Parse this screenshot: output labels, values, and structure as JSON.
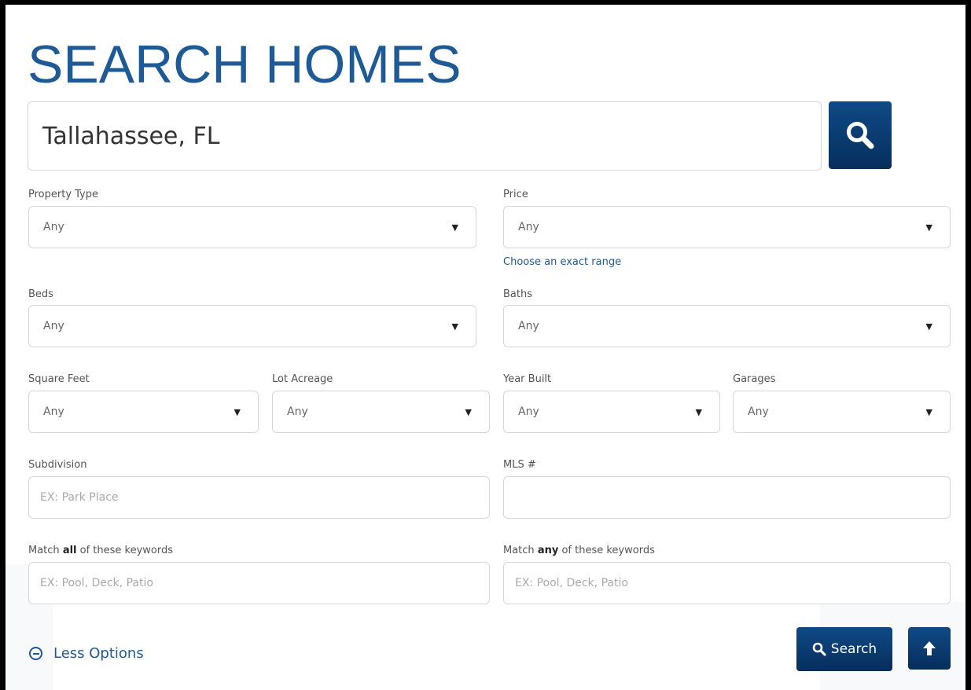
{
  "page": {
    "title": "SEARCH HOMES"
  },
  "search": {
    "value": "Tallahassee, FL"
  },
  "filters": {
    "property_type": {
      "label": "Property Type",
      "value": "Any"
    },
    "price": {
      "label": "Price",
      "value": "Any",
      "range_link": "Choose an exact range"
    },
    "beds": {
      "label": "Beds",
      "value": "Any"
    },
    "baths": {
      "label": "Baths",
      "value": "Any"
    },
    "square_feet": {
      "label": "Square Feet",
      "value": "Any"
    },
    "lot_acreage": {
      "label": "Lot Acreage",
      "value": "Any"
    },
    "year_built": {
      "label": "Year Built",
      "value": "Any"
    },
    "garages": {
      "label": "Garages",
      "value": "Any"
    },
    "subdivision": {
      "label": "Subdivision",
      "placeholder": "EX: Park Place"
    },
    "mls": {
      "label": "MLS #",
      "placeholder": ""
    },
    "keywords_all": {
      "label_prefix": "Match ",
      "label_bold": "all",
      "label_suffix": " of these keywords",
      "placeholder": "EX: Pool, Deck, Patio"
    },
    "keywords_any": {
      "label_prefix": "Match ",
      "label_bold": "any",
      "label_suffix": " of these keywords",
      "placeholder": "EX: Pool, Deck, Patio"
    }
  },
  "actions": {
    "less_options": "Less Options",
    "search_label": "Search"
  },
  "icons": {
    "search": "search-icon",
    "collapse": "minus-circle-icon",
    "scroll_up": "arrow-up-icon"
  },
  "colors": {
    "accent": "#1d5a96",
    "button": "#0b3f78"
  }
}
